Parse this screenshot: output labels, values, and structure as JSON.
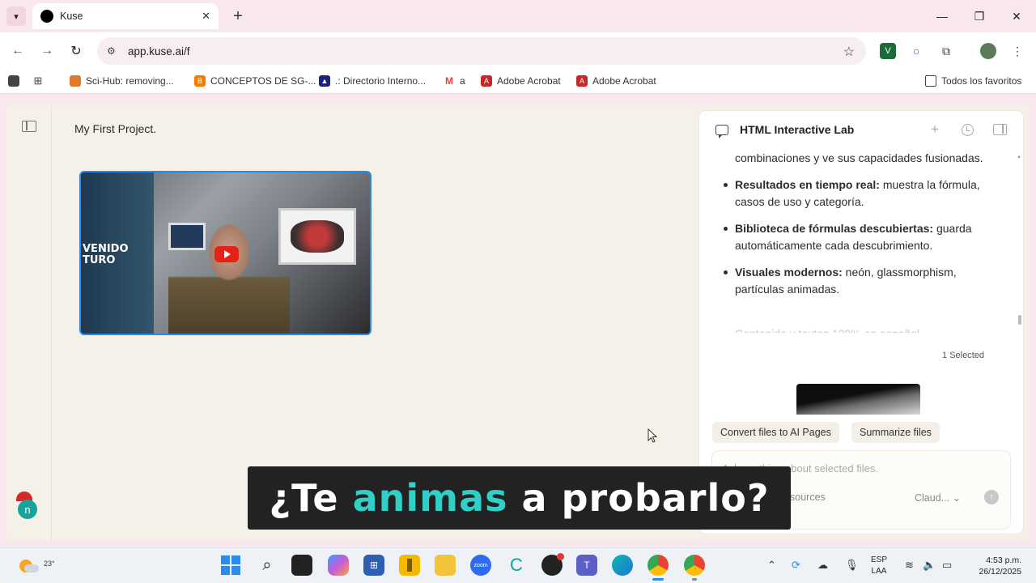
{
  "browser": {
    "tab_title": "Kuse",
    "url": "app.kuse.ai/f",
    "bookmarks": [
      {
        "label": "Sci-Hub: removing...",
        "color": "#e07a2a"
      },
      {
        "label": "CONCEPTOS DE SG-...",
        "color": "#f57c00"
      },
      {
        "label": ".: Directorio Interno...",
        "color": "#1a237e"
      },
      {
        "label": "a",
        "color": "#ea4335"
      },
      {
        "label": "Adobe Acrobat",
        "color": "#c62828"
      },
      {
        "label": "Adobe Acrobat",
        "color": "#c62828"
      }
    ],
    "all_bookmarks_label": "Todos los favoritos"
  },
  "app": {
    "project_title": "My First Project.",
    "video": {
      "overlay_text": "VENIDO\nTURO"
    },
    "avatar_letter": "n"
  },
  "panel": {
    "title": "HTML Interactive Lab",
    "intro": "combinaciones y ve sus capacidades fusionadas.",
    "bullets": [
      {
        "bold": "Resultados en tiempo real:",
        "text": " muestra la fórmula, casos de uso y categoría."
      },
      {
        "bold": "Biblioteca de fórmulas descubiertas:",
        "text": " guarda automáticamente cada descubrimiento."
      },
      {
        "bold": "Visuales modernos:",
        "text": " neón, glassmorphism, partículas animadas."
      }
    ],
    "faded_line": "Contenido y textos 100% en español",
    "selected_count": "1 Selected",
    "chips": [
      "Convert files to AI Pages",
      "Summarize files"
    ],
    "input_placeholder": "Ask anything about selected files.",
    "sources_label": "sources",
    "model_label": "Claud...",
    "model_chevron": "⌄"
  },
  "caption": {
    "before": "¿Te ",
    "highlight": "animas",
    "after": " a probarlo?"
  },
  "taskbar": {
    "temperature": "23°",
    "language": "ESP",
    "keyboard": "LAA",
    "time": "4:53 p.m.",
    "date": "26/12/2025",
    "colors": {
      "accent": "#2a8cf0"
    }
  }
}
